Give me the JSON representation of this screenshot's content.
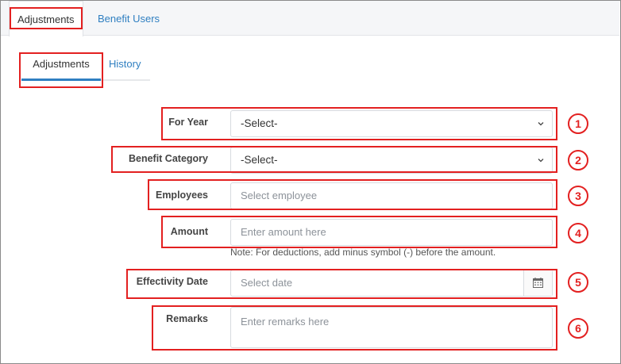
{
  "top_tabs": [
    {
      "label": "Adjustments",
      "active": true
    },
    {
      "label": "Benefit Users",
      "active": false
    }
  ],
  "sub_tabs": [
    {
      "label": "Adjustments",
      "active": true
    },
    {
      "label": "History",
      "active": false
    }
  ],
  "form": {
    "for_year": {
      "label": "For Year",
      "value": "-Select-"
    },
    "benefit_category": {
      "label": "Benefit Category",
      "value": "-Select-"
    },
    "employees": {
      "label": "Employees",
      "placeholder": "Select employee"
    },
    "amount": {
      "label": "Amount",
      "placeholder": "Enter amount here",
      "note": "Note: For deductions, add minus symbol (-) before the amount."
    },
    "effectivity_date": {
      "label": "Effectivity Date",
      "placeholder": "Select date",
      "icon": "calendar-icon"
    },
    "remarks": {
      "label": "Remarks",
      "placeholder": "Enter remarks here"
    }
  },
  "annotations": [
    "1",
    "2",
    "3",
    "4",
    "5",
    "6"
  ],
  "colors": {
    "highlight": "#e32020",
    "link": "#2f7fc1"
  }
}
